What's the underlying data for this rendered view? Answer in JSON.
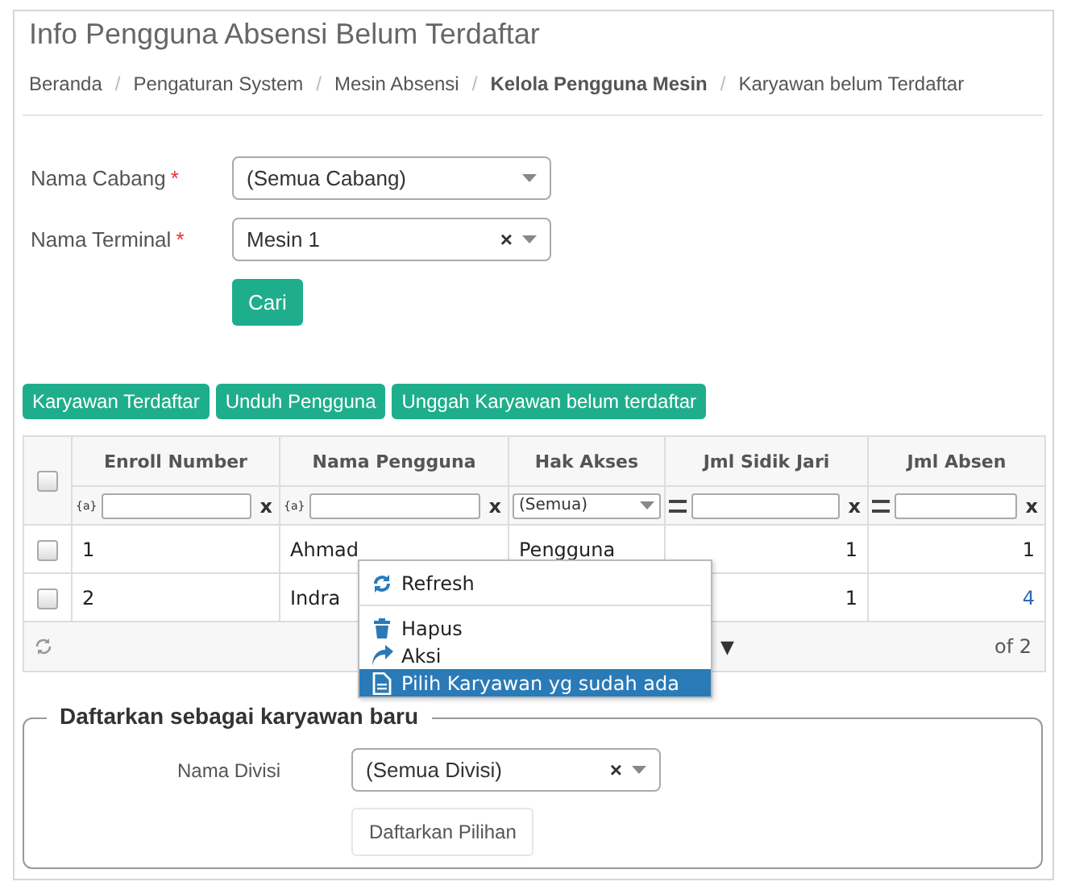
{
  "page_title": "Info Pengguna Absensi Belum Terdaftar",
  "breadcrumb": [
    {
      "label": "Beranda",
      "current": false
    },
    {
      "label": "Pengaturan System",
      "current": false
    },
    {
      "label": "Mesin Absensi",
      "current": false
    },
    {
      "label": "Kelola Pengguna Mesin",
      "current": true
    },
    {
      "label": "Karyawan belum Terdaftar",
      "current": false
    }
  ],
  "breadcrumb_separator": "/",
  "form": {
    "fields": [
      {
        "label": "Nama Cabang",
        "required": true,
        "required_mark": "*",
        "value": "(Semua Cabang)"
      },
      {
        "label": "Nama Terminal",
        "required": true,
        "required_mark": "*",
        "value": "Mesin 1",
        "clear": "×"
      }
    ],
    "submit": "Cari"
  },
  "actions": [
    "Karyawan Terdaftar",
    "Unduh Pengguna",
    "Unggah Karyawan belum terdaftar"
  ],
  "table": {
    "header_checked": false,
    "columns": [
      {
        "label": "Enroll Number",
        "filter": {
          "kind": "text",
          "prefix": "{a}",
          "clear": "x"
        }
      },
      {
        "label": "Nama Pengguna",
        "filter": {
          "kind": "text",
          "prefix": "{a}",
          "clear": "x"
        }
      },
      {
        "label": "Hak Akses",
        "filter": {
          "kind": "select",
          "value": "(Semua)"
        }
      },
      {
        "label": "Jml Sidik Jari",
        "filter": {
          "kind": "number",
          "clear": "x"
        }
      },
      {
        "label": "Jml Absen",
        "filter": {
          "kind": "number",
          "clear": "x"
        }
      }
    ],
    "rows": [
      {
        "checked": false,
        "cells": [
          "1",
          "Ahmad",
          "Pengguna",
          "1",
          "1"
        ],
        "absen_link": false
      },
      {
        "checked": false,
        "cells": [
          "2",
          "Indra",
          null,
          "1",
          "4"
        ],
        "absen_link": true
      }
    ],
    "pager": {
      "dropdown": "▼",
      "page_info": "of 2"
    }
  },
  "context_menu": {
    "items": [
      {
        "kind": "refresh",
        "label": "Refresh",
        "selected": false,
        "separator_after": true
      },
      {
        "kind": "trash",
        "label": "Hapus",
        "selected": false,
        "separator_after": false
      },
      {
        "kind": "share",
        "label": "Aksi",
        "selected": false,
        "separator_after": false
      },
      {
        "kind": "file",
        "label": "Pilih Karyawan yg sudah ada",
        "selected": true,
        "separator_after": false
      }
    ]
  },
  "register": {
    "legend": "Daftarkan sebagai karyawan baru",
    "field": {
      "label": "Nama Divisi",
      "value": "(Semua Divisi)",
      "clear": "×"
    },
    "button": "Daftarkan Pilihan"
  }
}
